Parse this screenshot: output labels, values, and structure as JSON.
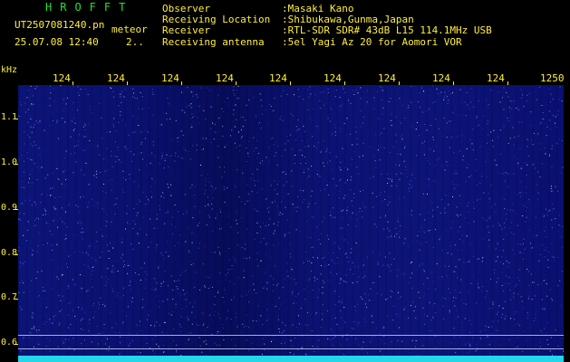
{
  "app": {
    "title": "HROFFT"
  },
  "file": {
    "name": "UT2507081240.pn",
    "type": "meteor",
    "datetime": "25.07.08 12:40",
    "count": "2.."
  },
  "meta": [
    {
      "label": "Observer",
      "value": ":Masaki Kano"
    },
    {
      "label": "Receiving Location",
      "value": ":Shibukawa,Gunma,Japan"
    },
    {
      "label": "Receiver",
      "value": ":RTL-SDR SDR# 43dB L15 114.1MHz USB"
    },
    {
      "label": "Receiving antenna",
      "value": ":5el Yagi Az 20 for Aomori VOR"
    }
  ],
  "axis": {
    "y_unit": "kHz",
    "x_ticks": [
      "124",
      "124",
      "124",
      "124",
      "124",
      "124",
      "124",
      "124",
      "124",
      "1250"
    ],
    "y_ticks": [
      "1.1",
      "1.0",
      "0.9",
      "0.8",
      "0.7",
      "0.6"
    ]
  },
  "colors": {
    "text": "#ffef3a",
    "title": "#22e03a",
    "background": "#000000",
    "trace": "#23d6e8",
    "plot": "#0c1478"
  }
}
